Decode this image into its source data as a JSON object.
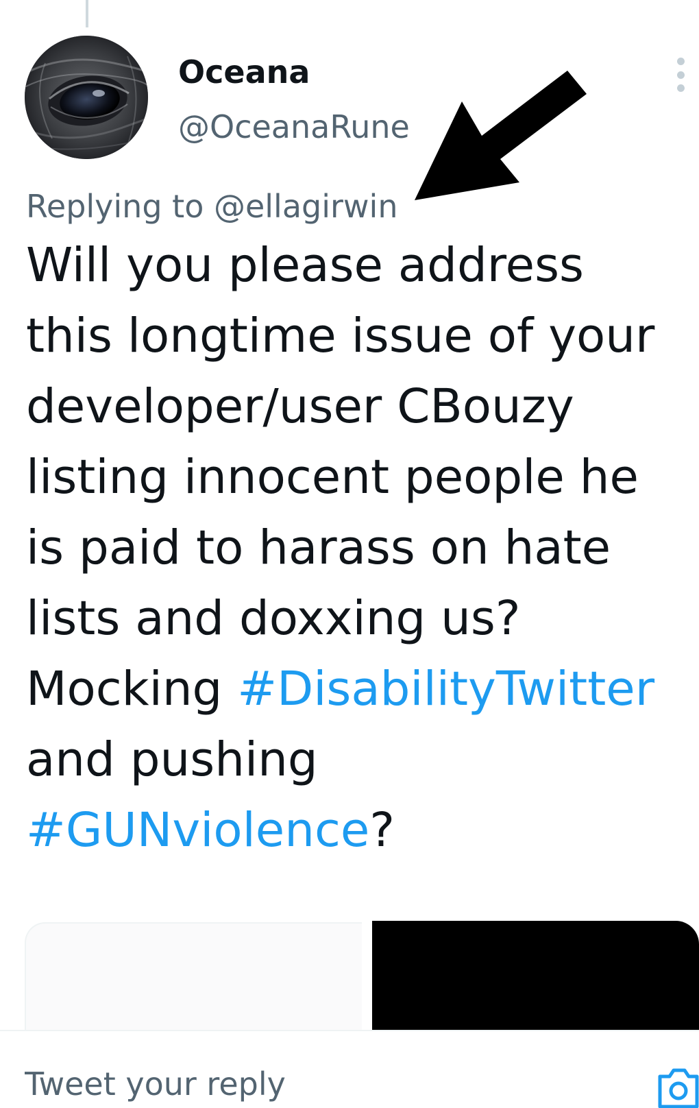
{
  "tweet": {
    "author": {
      "display_name": "Oceana",
      "handle": "@OceanaRune"
    },
    "reply_context": {
      "prefix": "Replying to ",
      "mention": "@ellagirwin"
    },
    "text_segments": {
      "part1": "Will you please address this longtime issue of your developer/user CBouzy listing innocent people he is paid to harass on hate lists and doxxing us? Mocking ",
      "hashtag1": "#DisabilityTwitter",
      "part2": " and pushing ",
      "hashtag2": "#GUNviolence",
      "part3": "?"
    },
    "more_icon": "more-vertical-icon"
  },
  "annotation": {
    "icon": "arrow-pointer-icon",
    "color": "#000000"
  },
  "reply_bar": {
    "placeholder": "Tweet your reply",
    "camera_icon": "camera-icon"
  },
  "colors": {
    "accent": "#1d9bf0",
    "text_primary": "#0f1419",
    "text_secondary": "#536471"
  }
}
